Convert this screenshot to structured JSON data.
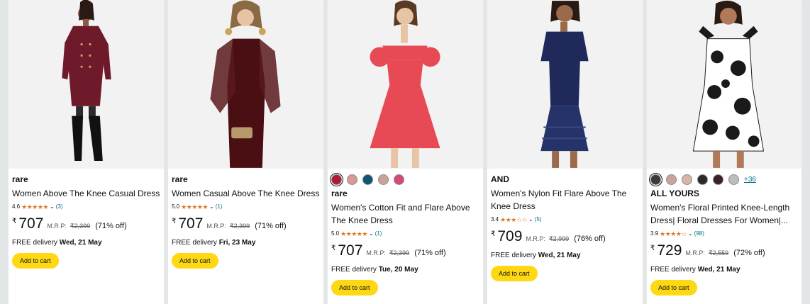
{
  "products": [
    {
      "brand": "rare",
      "title": "Women Above The Knee Casual Dress",
      "rating": "4.6",
      "stars": "★★★★★",
      "reviews": "(3)",
      "currency": "₹",
      "price": "707",
      "mrp_label": "M.R.P:",
      "mrp": "₹2,399",
      "discount": "(71% off)",
      "delivery_prefix": "FREE delivery ",
      "delivery_date": "Wed, 21 May",
      "cart_label": "Add to cart",
      "dress_color": "#6e1a2a"
    },
    {
      "brand": "rare",
      "title": "Women Casual Above The Knee Dress",
      "rating": "5.0",
      "stars": "★★★★★",
      "reviews": "(1)",
      "currency": "₹",
      "price": "707",
      "mrp_label": "M.R.P:",
      "mrp": "₹2,399",
      "discount": "(71% off)",
      "delivery_prefix": "FREE delivery ",
      "delivery_date": "Fri, 23 May",
      "cart_label": "Add to cart",
      "dress_color": "#4a0f12"
    },
    {
      "brand": "rare",
      "title": "Women's Cotton Fit and Flare Above The Knee Dress",
      "rating": "5.0",
      "stars": "★★★★★",
      "reviews": "(1)",
      "currency": "₹",
      "price": "707",
      "mrp_label": "M.R.P:",
      "mrp": "₹2,399",
      "discount": "(71% off)",
      "delivery_prefix": "FREE delivery ",
      "delivery_date": "Tue, 20 May",
      "cart_label": "Add to cart",
      "dress_color": "#e84a55",
      "swatches": [
        "#b0183a",
        "#d99a95",
        "#0f5673",
        "#c9a49a",
        "#d34a72"
      ]
    },
    {
      "brand": "AND",
      "title": "Women's Nylon Fit Flare Above The Knee Dress",
      "rating": "3.4",
      "stars": "★★★☆☆",
      "reviews": "(5)",
      "currency": "₹",
      "price": "709",
      "mrp_label": "M.R.P:",
      "mrp": "₹2,999",
      "discount": "(76% off)",
      "delivery_prefix": "FREE delivery ",
      "delivery_date": "Wed, 21 May",
      "cart_label": "Add to cart",
      "dress_color": "#1f2a5a"
    },
    {
      "brand": "ALL YOURS",
      "title": "Women's Floral Printed Knee-Length Dress| Floral Dresses For Women|...",
      "rating": "3.9",
      "stars": "★★★★☆",
      "reviews": "(98)",
      "currency": "₹",
      "price": "729",
      "mrp_label": "M.R.P:",
      "mrp": "₹2,559",
      "discount": "(72% off)",
      "delivery_prefix": "FREE delivery ",
      "delivery_date": "Wed, 21 May",
      "cart_label": "Add to cart",
      "dress_color": "#1a1a1a",
      "swatches": [
        "#3a3a3a",
        "#c9a49a",
        "#d8b5a8",
        "#2a2a2a",
        "#3a2226",
        "#bdbdbd"
      ],
      "more_swatches": "+36"
    }
  ]
}
